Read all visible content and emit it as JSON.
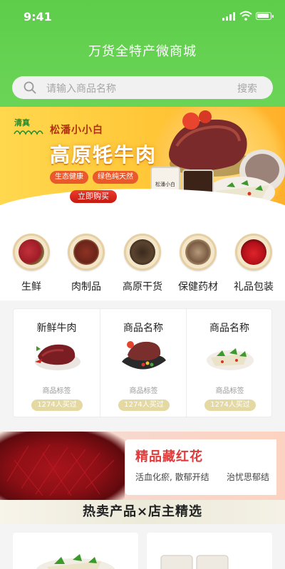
{
  "status": {
    "time": "9:41"
  },
  "header": {
    "title": "万货全特产微商城"
  },
  "search": {
    "placeholder": "请输入商品名称",
    "button_label": "搜索"
  },
  "banner": {
    "logo_text": "清真",
    "brand": "松潘小小白",
    "headline": "高原牦牛肉",
    "tags": [
      "生态健康",
      "绿色纯天然"
    ],
    "cta_label": "立即购买",
    "jar_label": "松潘小白"
  },
  "categories": [
    {
      "label": "生鲜",
      "icon": "fresh-meat-icon"
    },
    {
      "label": "肉制品",
      "icon": "meat-products-icon"
    },
    {
      "label": "高原干货",
      "icon": "dried-goods-icon"
    },
    {
      "label": "保健药材",
      "icon": "herbs-icon"
    },
    {
      "label": "礼品包装",
      "icon": "gift-box-icon"
    }
  ],
  "products": [
    {
      "name": "新鲜牛肉",
      "tag": "商品标签",
      "sold": "1274人买过"
    },
    {
      "name": "商品名称",
      "tag": "商品标签",
      "sold": "1274人买过"
    },
    {
      "name": "商品名称",
      "tag": "商品标签",
      "sold": "1274人买过"
    }
  ],
  "promo": {
    "title": "精品藏红花",
    "desc1": "活血化瘀,  散郁开结",
    "desc2": "治忧思郁结"
  },
  "section": {
    "title": "热卖产品×店主精选"
  },
  "colors": {
    "header_green": "#62d04f",
    "accent_red": "#e03a3a",
    "badge_gold": "#e4d9a3"
  }
}
